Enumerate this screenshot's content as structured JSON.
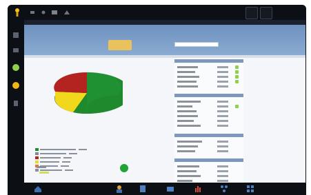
{
  "colors": {
    "frame": "#0c0f14",
    "header_blue": "#7d9ec8",
    "pie_green": "#1f8a2d",
    "pie_red": "#b3231f",
    "pie_yellow": "#f1d81c",
    "check_green": "#8fd14a",
    "status_green": "#21a336"
  },
  "top_toolbar": {
    "icons": [
      "app-logo-icon",
      "toolbar-icon-1",
      "toolbar-icon-2",
      "toolbar-icon-3",
      "toolbar-icon-4",
      "window-icon",
      "menu-icon"
    ]
  },
  "left_sidebar": {
    "icons": [
      "sidebar-icon-1",
      "sidebar-icon-2",
      "status-green-icon",
      "status-yellow-icon",
      "sidebar-icon-5"
    ]
  },
  "bottom_taskbar": {
    "icons": [
      "home-icon",
      "user-icon",
      "document-icon",
      "mail-icon",
      "chart-icon",
      "network-icon",
      "grid-icon"
    ]
  }
}
